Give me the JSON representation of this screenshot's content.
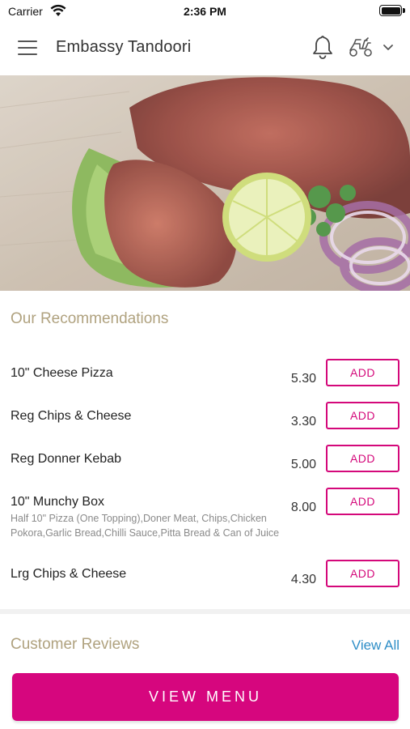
{
  "status_bar": {
    "carrier": "Carrier",
    "time": "2:36 PM",
    "battery_level": 1.0
  },
  "header": {
    "title": "Embassy Tandoori",
    "icons": [
      "menu-icon",
      "bell-icon",
      "scooter-icon",
      "chevron-down-icon"
    ]
  },
  "hero": {
    "image": "tandoori-chicken-with-lime-parsley-onion"
  },
  "recommendations": {
    "title": "Our Recommendations",
    "items": [
      {
        "name": "10\" Cheese Pizza",
        "description": "",
        "price": "5.30",
        "button": "ADD"
      },
      {
        "name": "Reg Chips & Cheese",
        "description": "",
        "price": "3.30",
        "button": "ADD"
      },
      {
        "name": "Reg Donner Kebab",
        "description": "",
        "price": "5.00",
        "button": "ADD"
      },
      {
        "name": "10\" Munchy Box",
        "description": "Half 10\" Pizza (One Topping),Doner Meat, Chips,Chicken Pokora,Garlic Bread,Chilli Sauce,Pitta Bread & Can of Juice",
        "price": "8.00",
        "button": "ADD"
      },
      {
        "name": "Lrg Chips & Cheese",
        "description": "",
        "price": "4.30",
        "button": "ADD"
      }
    ]
  },
  "reviews": {
    "title": "Customer Reviews",
    "view_all": "View All"
  },
  "footer": {
    "view_menu": "VIEW MENU"
  },
  "colors": {
    "accent": "#d6067e",
    "section_title": "#b0a27f",
    "link": "#2e8ec7"
  }
}
